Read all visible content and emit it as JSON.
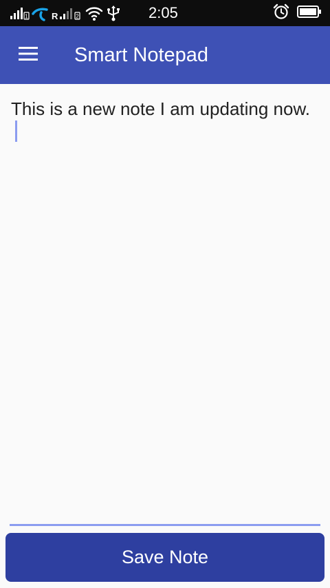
{
  "status_bar": {
    "time": "2:05",
    "sim1_badge": "1",
    "roaming_label": "R",
    "sim2_badge": "2",
    "icons": [
      "signal-sim1-icon",
      "operator-logo-icon",
      "signal-sim2-icon",
      "wifi-icon",
      "usb-icon",
      "alarm-icon",
      "battery-icon"
    ]
  },
  "app_bar": {
    "title": "Smart Notepad",
    "menu_icon": "hamburger-menu-icon"
  },
  "note": {
    "text": "This is a new note I am updating now."
  },
  "actions": {
    "save_label": "Save Note"
  },
  "colors": {
    "status_bar_bg": "#0d0d0d",
    "app_bar_bg": "#3e51b5",
    "save_button_bg": "#2e3fa0",
    "accent": "#8b9cf0",
    "page_bg": "#fafafa",
    "text": "#212121"
  }
}
